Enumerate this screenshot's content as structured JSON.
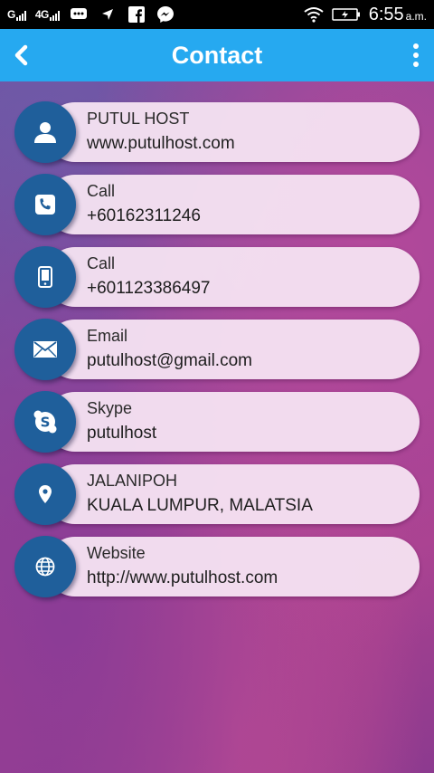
{
  "status_bar": {
    "signal1": "G",
    "signal2": "4G",
    "time": "6:55",
    "ampm": "a.m."
  },
  "header": {
    "title": "Contact"
  },
  "contacts": [
    {
      "label": "PUTUL HOST",
      "value": "www.putulhost.com",
      "icon": "person-icon"
    },
    {
      "label": "Call",
      "value": "+60162311246",
      "icon": "phone-icon"
    },
    {
      "label": "Call",
      "value": "+601123386497",
      "icon": "mobile-icon"
    },
    {
      "label": "Email",
      "value": "putulhost@gmail.com",
      "icon": "email-icon"
    },
    {
      "label": "Skype",
      "value": "putulhost",
      "icon": "skype-icon"
    },
    {
      "label": "JALANIPOH",
      "value": "KUALA LUMPUR, MALATSIA",
      "icon": "location-pin-icon"
    },
    {
      "label": "Website",
      "value": "http://www.putulhost.com",
      "icon": "globe-icon"
    }
  ],
  "colors": {
    "app_bar": "#26a9f0",
    "badge": "#1f5f9b",
    "card": "#f6e4f2"
  }
}
